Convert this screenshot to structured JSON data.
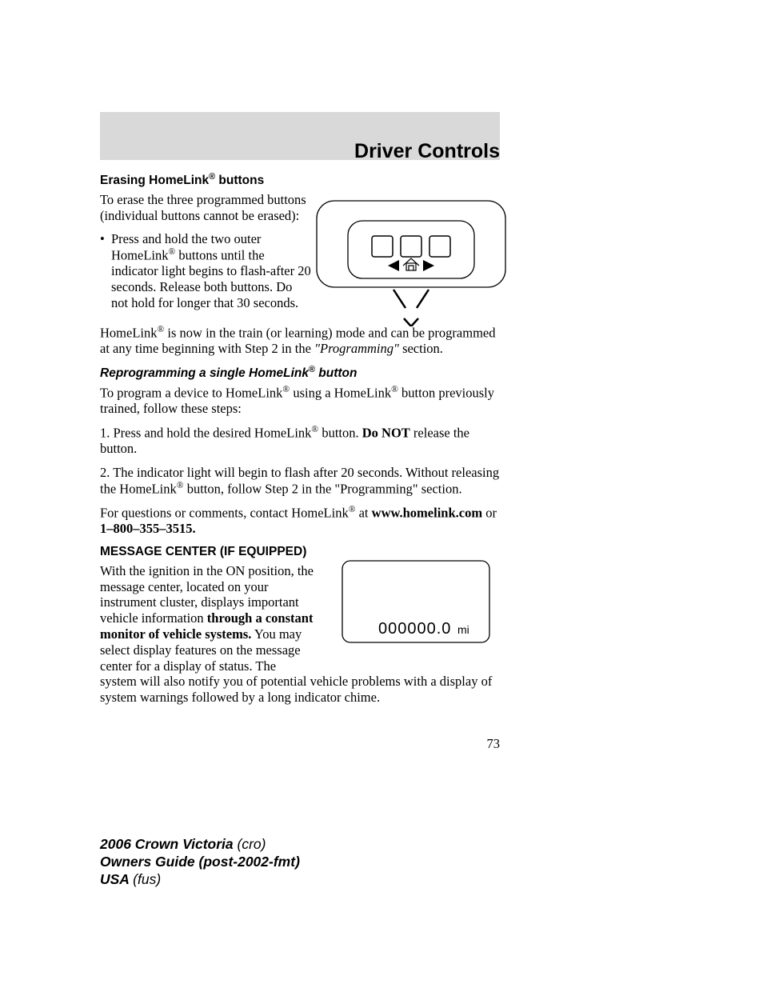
{
  "chapter_title": "Driver Controls",
  "section1": {
    "heading": "Erasing HomeLink",
    "heading_suffix": " buttons",
    "p1": "To erase the three programmed buttons (individual buttons cannot be erased):",
    "bullet1": "Press and hold the two outer HomeLink",
    "bullet1b": " buttons until the indicator light begins to flash-after 20 seconds. Release both buttons. Do not hold for longer that 30 seconds.",
    "p2a": "HomeLink",
    "p2b": " is now in the train (or learning) mode and can be programmed at any time beginning with Step 2 in the ",
    "p2c": "\"Programming\"",
    "p2d": " section."
  },
  "section2": {
    "heading": "Reprogramming a single HomeLink",
    "heading_suffix": " button",
    "p1a": "To program a device to HomeLink",
    "p1b": " using a HomeLink",
    "p1c": " button previously trained, follow these steps:",
    "p2a": "1. Press and hold the desired HomeLink",
    "p2b": " button. ",
    "p2c": "Do NOT",
    "p2d": " release the button.",
    "p3a": "2. The indicator light will begin to flash after 20 seconds. Without releasing the HomeLink",
    "p3b": " button, follow Step 2 in the \"Programming\" section.",
    "p4a": "For questions or comments, contact HomeLink",
    "p4b": " at ",
    "p4c": "www.homelink.com",
    "p4d": " or ",
    "p4e": "1–800–355–3515."
  },
  "section3": {
    "heading": "MESSAGE CENTER (IF EQUIPPED)",
    "p1a": "With the ignition in the ON position, the message center, located on your instrument cluster, displays important vehicle information ",
    "p1b": "through a constant monitor of vehicle systems.",
    "p1c": " You may select display features on the message center for a display of status. The system will also notify you of potential vehicle problems with a display of system warnings followed by a long indicator chime."
  },
  "odometer": {
    "value": "000000.0",
    "unit": "mi"
  },
  "page_number": "73",
  "footer": {
    "line1a": "2006 Crown Victoria ",
    "line1b": "(cro)",
    "line2": "Owners Guide (post-2002-fmt)",
    "line3a": "USA ",
    "line3b": "(fus)"
  },
  "reg": "®"
}
